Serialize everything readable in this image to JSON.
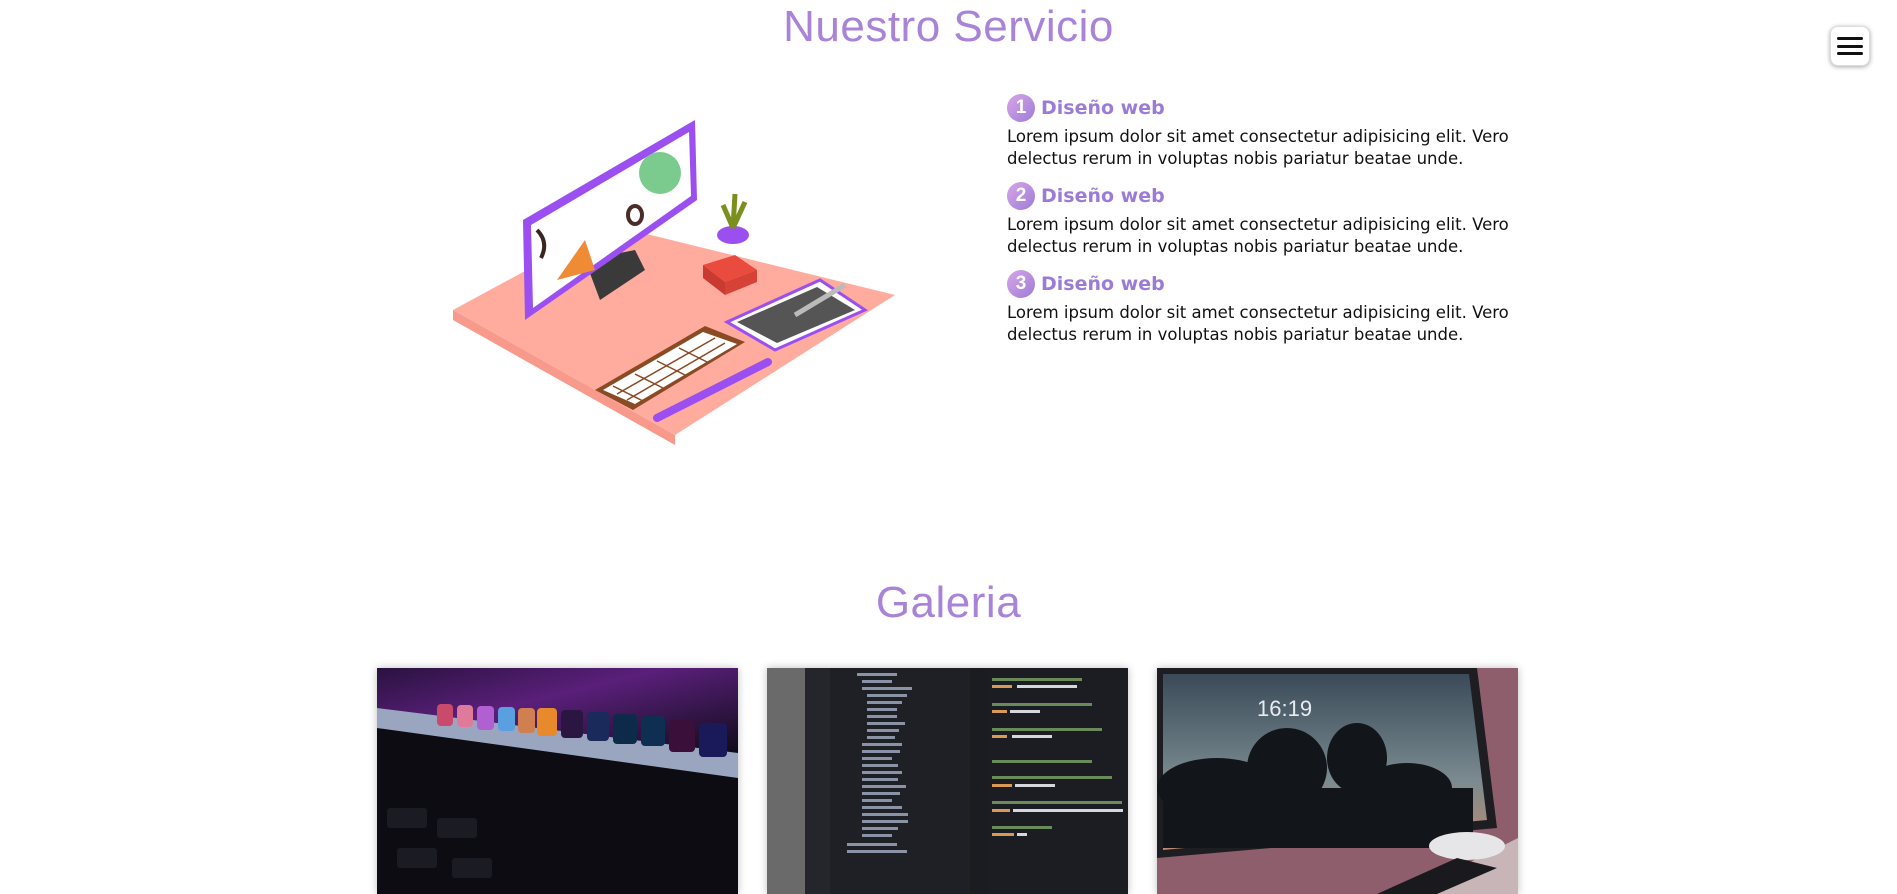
{
  "service": {
    "title": "Nuestro Servicio",
    "items": [
      {
        "number": "1",
        "name": "Diseño web",
        "description": "Lorem ipsum dolor sit amet consectetur adipisicing elit. Vero delectus rerum in voluptas nobis pariatur beatae unde."
      },
      {
        "number": "2",
        "name": "Diseño web",
        "description": "Lorem ipsum dolor sit amet consectetur adipisicing elit. Vero delectus rerum in voluptas nobis pariatur beatae unde."
      },
      {
        "number": "3",
        "name": "Diseño web",
        "description": "Lorem ipsum dolor sit amet consectetur adipisicing elit. Vero delectus rerum in voluptas nobis pariatur beatae unde."
      }
    ]
  },
  "gallery": {
    "title": "Galeria",
    "photo3": {
      "clock": "16:19"
    }
  },
  "menu": {
    "icon": "hamburger-menu-icon"
  },
  "colors": {
    "accent": "#a883d8",
    "badge": "#9c7bd6"
  }
}
